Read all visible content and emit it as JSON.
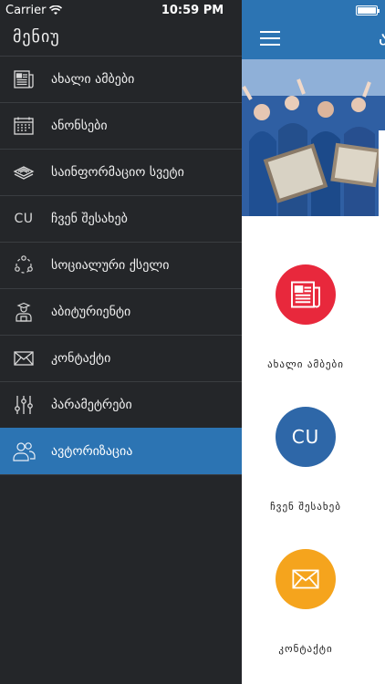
{
  "status_bar": {
    "carrier": "Carrier",
    "time": "10:59 PM"
  },
  "drawer": {
    "title": "მენიუ",
    "items": [
      {
        "label": "ახალი ამბები",
        "icon": "newspaper-icon"
      },
      {
        "label": "ანონსები",
        "icon": "calendar-icon"
      },
      {
        "label": "საინფორმაციო სვეტი",
        "icon": "stack-of-papers-icon"
      },
      {
        "label": "ჩვენ შესახებ",
        "icon": "cu-logo-icon",
        "icon_text": "CU"
      },
      {
        "label": "სოციალური ქსელი",
        "icon": "social-network-icon"
      },
      {
        "label": "აბიტურიენტი",
        "icon": "student-icon"
      },
      {
        "label": "კონტაქტი",
        "icon": "envelope-icon"
      },
      {
        "label": "პარამეტრები",
        "icon": "sliders-icon"
      },
      {
        "label": "ავტორიზაცია",
        "icon": "users-icon",
        "active": true
      }
    ]
  },
  "main": {
    "topbar_title": "ამ",
    "features": [
      {
        "caption": "ახალი ამბები",
        "color": "#e8283c",
        "icon": "newspaper-icon"
      },
      {
        "caption": "ჩვენ შესახებ",
        "color": "#2e67a8",
        "icon": "cu-logo-icon",
        "icon_text": "CU"
      },
      {
        "caption": "კონტაქტი",
        "color": "#f5a41d",
        "icon": "envelope-icon"
      }
    ]
  },
  "colors": {
    "drawer_bg": "#242629",
    "accent": "#2c74b3"
  }
}
